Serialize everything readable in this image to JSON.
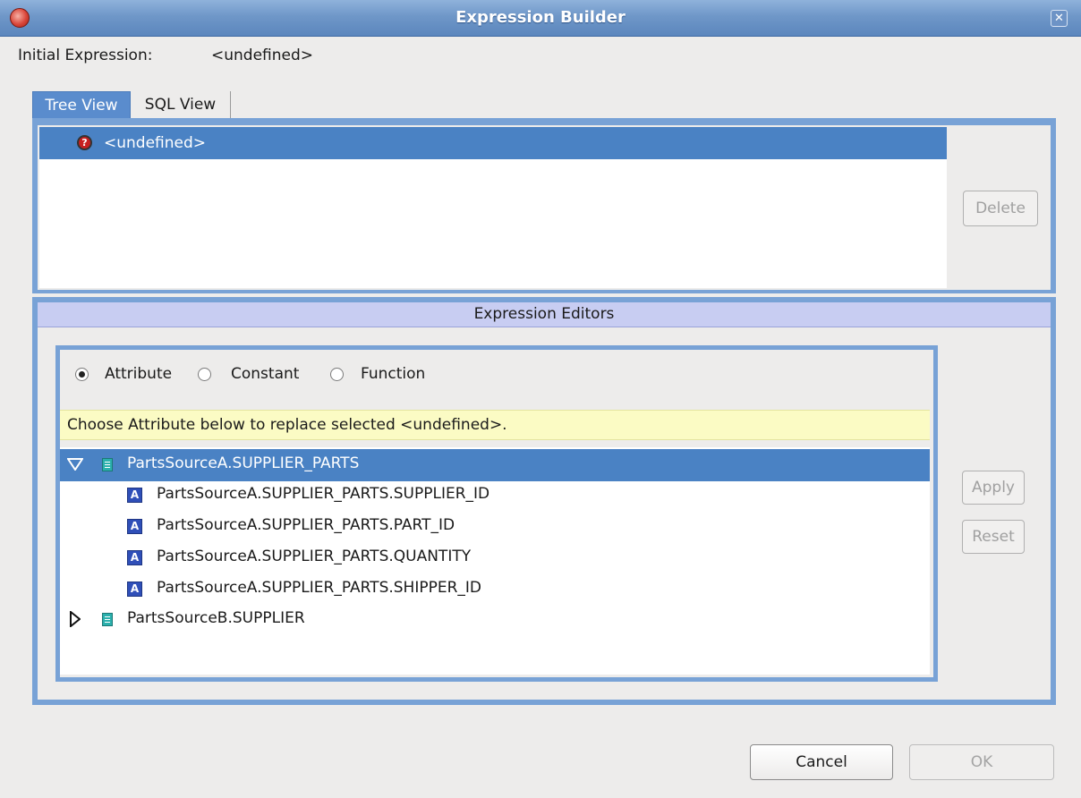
{
  "window": {
    "title": "Expression Builder",
    "close_glyph": "✕"
  },
  "initial": {
    "label": "Initial Expression:",
    "value": "<undefined>"
  },
  "tabs": [
    {
      "label": "Tree View",
      "selected": true
    },
    {
      "label": "SQL View",
      "selected": false
    }
  ],
  "tree": {
    "selected_node": {
      "label": "<undefined>",
      "icon": "undefined-node-icon"
    },
    "delete_label": "Delete"
  },
  "editors": {
    "header": "Expression Editors",
    "radios": [
      {
        "label": "Attribute",
        "checked": true
      },
      {
        "label": "Constant",
        "checked": false
      },
      {
        "label": "Function",
        "checked": false
      }
    ],
    "hint": "Choose Attribute below to replace selected <undefined>.",
    "attributes": {
      "groups": [
        {
          "label": "PartsSourceA.SUPPLIER_PARTS",
          "expanded": true,
          "selected": true,
          "children": [
            "PartsSourceA.SUPPLIER_PARTS.SUPPLIER_ID",
            "PartsSourceA.SUPPLIER_PARTS.PART_ID",
            "PartsSourceA.SUPPLIER_PARTS.QUANTITY",
            "PartsSourceA.SUPPLIER_PARTS.SHIPPER_ID"
          ]
        },
        {
          "label": "PartsSourceB.SUPPLIER",
          "expanded": false,
          "selected": false,
          "children": []
        }
      ]
    },
    "apply_label": "Apply",
    "reset_label": "Reset"
  },
  "footer": {
    "cancel_label": "Cancel",
    "ok_label": "OK"
  },
  "colors": {
    "titlebar": "#6f97c8",
    "selection": "#4a82c4",
    "panel_border": "#78a2d6",
    "hint_bg": "#fbfbc4"
  }
}
